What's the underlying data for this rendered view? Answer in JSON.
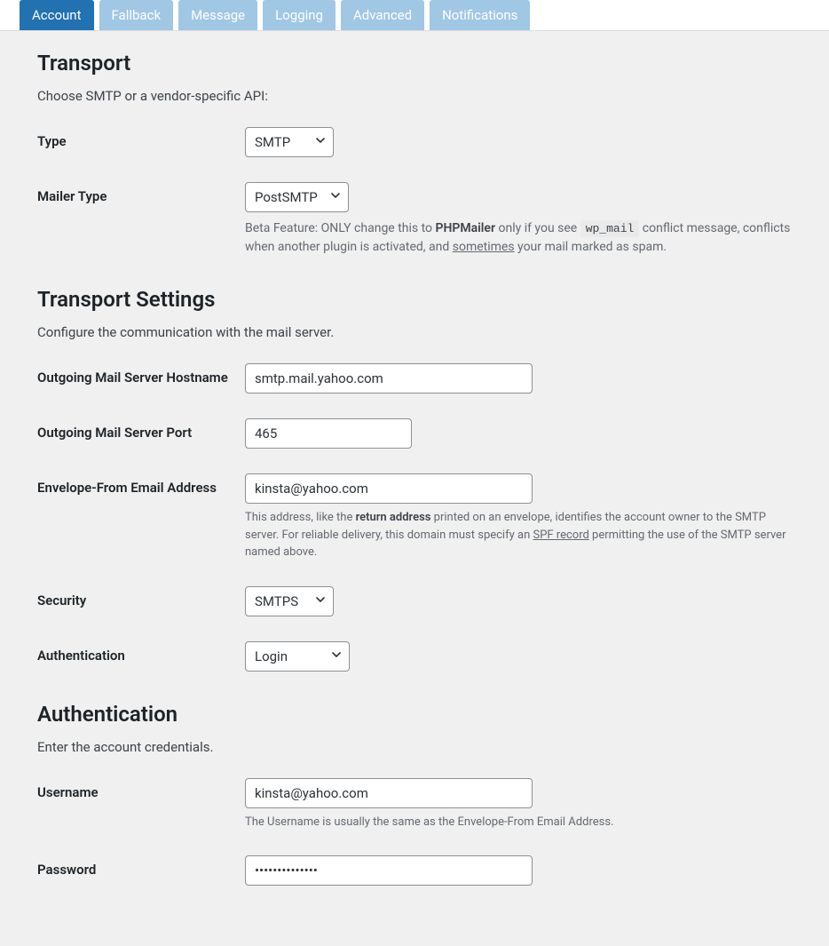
{
  "tabs": [
    {
      "label": "Account",
      "active": true
    },
    {
      "label": "Fallback",
      "active": false
    },
    {
      "label": "Message",
      "active": false
    },
    {
      "label": "Logging",
      "active": false
    },
    {
      "label": "Advanced",
      "active": false
    },
    {
      "label": "Notifications",
      "active": false
    }
  ],
  "transport": {
    "heading": "Transport",
    "intro": "Choose SMTP or a vendor-specific API:",
    "type_label": "Type",
    "type_value": "SMTP",
    "mailer_type_label": "Mailer Type",
    "mailer_type_value": "PostSMTP",
    "mailer_help_pre": "Beta Feature: ONLY change this to ",
    "mailer_help_bold": "PHPMailer",
    "mailer_help_mid": " only if you see ",
    "mailer_help_code": "wp_mail",
    "mailer_help_post1": " conflict message, conflicts when another plugin is activated, and ",
    "mailer_help_link": "sometimes",
    "mailer_help_post2": " your mail marked as spam."
  },
  "transport_settings": {
    "heading": "Transport Settings",
    "intro": "Configure the communication with the mail server.",
    "hostname_label": "Outgoing Mail Server Hostname",
    "hostname_value": "smtp.mail.yahoo.com",
    "port_label": "Outgoing Mail Server Port",
    "port_value": "465",
    "envelope_label": "Envelope-From Email Address",
    "envelope_value": "kinsta@yahoo.com",
    "envelope_help_pre": "This address, like the ",
    "envelope_help_bold": "return address",
    "envelope_help_mid": " printed on an envelope, identifies the account owner to the SMTP server. For reliable delivery, this domain must specify an ",
    "envelope_help_link": "SPF record",
    "envelope_help_post": " permitting the use of the SMTP server named above.",
    "security_label": "Security",
    "security_value": "SMTPS",
    "auth_label": "Authentication",
    "auth_value": "Login"
  },
  "authentication": {
    "heading": "Authentication",
    "intro": "Enter the account credentials.",
    "username_label": "Username",
    "username_value": "kinsta@yahoo.com",
    "username_help": "The Username is usually the same as the Envelope-From Email Address.",
    "password_label": "Password",
    "password_value": "••••••••••••••"
  }
}
